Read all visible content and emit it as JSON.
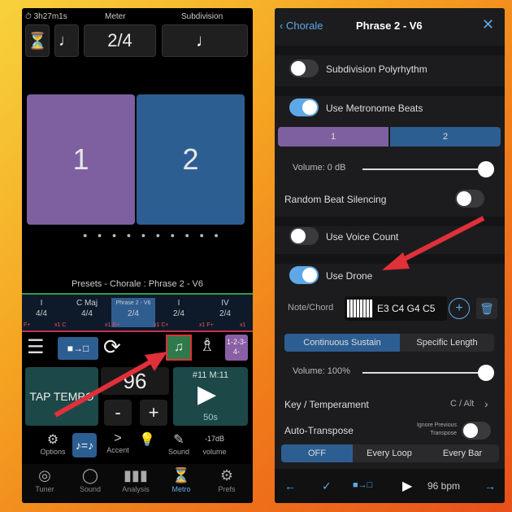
{
  "left": {
    "timer": "3h27m1s",
    "meter_label": "Meter",
    "subdivision_label": "Subdivision",
    "meter_value": "2/4",
    "beat1": "1",
    "beat2": "2",
    "presets_text": "Presets - Chorale : Phrase 2 - V6",
    "strip": [
      {
        "top": "I",
        "bot": "4/4",
        "sub": "F+"
      },
      {
        "top": "C Maj",
        "bot": "4/4",
        "sub": "x1 C"
      },
      {
        "top": "Phrase 2 - V6",
        "bot": "2/4",
        "sub": "x1 E+"
      },
      {
        "top": "I",
        "bot": "2/4",
        "sub": "x1 C+"
      },
      {
        "top": "IV",
        "bot": "2/4",
        "sub": "x1 F+"
      }
    ],
    "strip_tail": "x1",
    "count_label": "1-2-3-4-",
    "tap_tempo": "TAP TEMPO",
    "tempo": "96",
    "minus": "-",
    "plus": "+",
    "measure": "#11 M:11",
    "elapsed": "50s",
    "tools": {
      "options": "Options",
      "accent": "Accent",
      "sound": "Sound",
      "volume_val": "-17dB",
      "volume": "volume"
    },
    "nav": [
      "Tuner",
      "Sound",
      "Analysis",
      "Metro",
      "Prefs"
    ]
  },
  "right": {
    "back": "Chorale",
    "title": "Phrase 2 - V6",
    "subdivision_polyrhythm": "Subdivision Polyrhythm",
    "use_metronome_beats": "Use Metronome Beats",
    "beat_seg": [
      "1",
      "2"
    ],
    "volume_label": "Volume:  0 dB",
    "random_beat": "Random Beat Silencing",
    "use_voice_count": "Use Voice Count",
    "use_drone": "Use Drone",
    "note_chord_label": "Note/Chord",
    "chord": "E3 C4 G4 C5",
    "sustain_seg": [
      "Continuous Sustain",
      "Specific Length"
    ],
    "drone_volume": "Volume:  100%",
    "key_temp_label": "Key / Temperament",
    "key_temp_value": "C / Alt",
    "auto_transpose": "Auto-Transpose",
    "ignore_previous": "Ignore Previous Transpose",
    "transpose_seg": [
      "OFF",
      "Every Loop",
      "Every Bar"
    ],
    "bpm": "96 bpm"
  },
  "colors": {
    "purple": "#7e60a0",
    "blue": "#2d5e92",
    "teal": "#1c4848",
    "toggle_on": "#5fa8e6",
    "arrow": "#e0303a"
  }
}
